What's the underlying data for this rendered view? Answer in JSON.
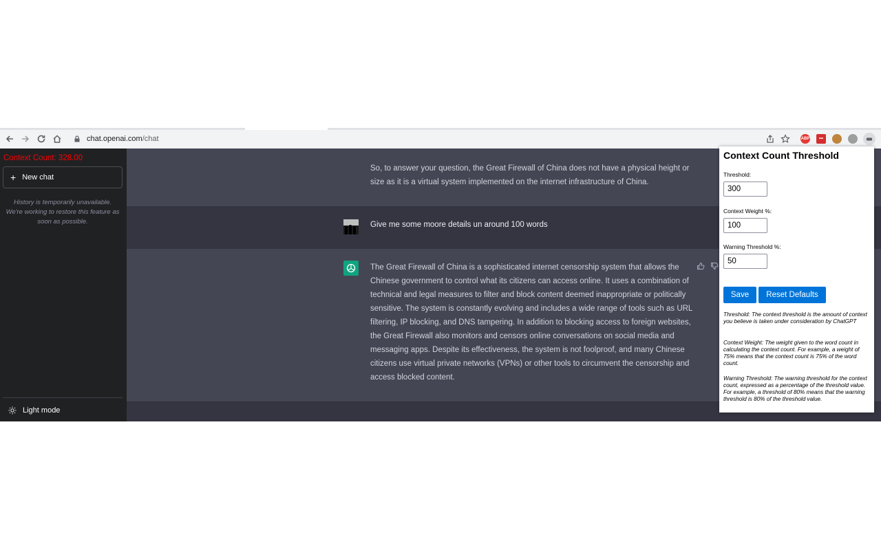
{
  "browser": {
    "url_domain": "chat.openai.com",
    "url_path": "/chat",
    "extensions": [
      {
        "name": "adblock-icon",
        "label": "ABP",
        "color": "#e53935"
      },
      {
        "name": "extension-red-icon",
        "label": "•••",
        "color": "#d32f2f"
      },
      {
        "name": "extension-cookie-icon",
        "label": "",
        "color": "#c0843d"
      },
      {
        "name": "extension-gray-icon",
        "label": "",
        "color": "#9e9e9e"
      },
      {
        "name": "extension-active-icon",
        "label": "",
        "color": "#5f6368"
      }
    ]
  },
  "sidebar": {
    "context_count": "Context Count: 328.00",
    "new_chat_label": "New chat",
    "history_notice": "History is temporarily unavailable. We're working to restore this feature as soon as possible.",
    "light_mode_label": "Light mode"
  },
  "chat": {
    "messages": [
      {
        "role": "assistant",
        "text": "So, to answer your question, the Great Firewall of China does not have a physical height or size as it is a virtual system implemented on the internet infrastructure of China."
      },
      {
        "role": "user",
        "text": "Give me some moore details un around 100 words"
      },
      {
        "role": "assistant",
        "text": "The Great Firewall of China is a sophisticated internet censorship system that allows the Chinese government to control what its citizens can access online. It uses a combination of technical and legal measures to filter and block content deemed inappropriate or politically sensitive. The system is constantly evolving and includes a wide range of tools such as URL filtering, IP blocking, and DNS tampering. In addition to blocking access to foreign websites, the Great Firewall also monitors and censors online conversations on social media and messaging apps. Despite its effectiveness, the system is not foolproof, and many Chinese citizens use virtual private networks (VPNs) or other tools to circumvent the censorship and access blocked content."
      }
    ]
  },
  "popup": {
    "title": "Context Count Threshold",
    "threshold_label": "Threshold:",
    "threshold_value": "300",
    "weight_label": "Context Weight %:",
    "weight_value": "100",
    "warning_label": "Warning Threshold %:",
    "warning_value": "50",
    "save_label": "Save",
    "reset_label": "Reset Defaults",
    "help_threshold": "Threshold: The context threshold is the amount of context you believe is taken under consideration by ChatGPT",
    "help_weight": "Context Weight: The weight given to the word count in calculating the context count. For example, a weight of 75% means that the context count is 75% of the word count.",
    "help_warning": "Warning Threshold: The warning threshold for the context count, expressed as a percentage of the threshold value. For example, a threshold of 80% means that the warning threshold is 80% of the threshold value."
  }
}
